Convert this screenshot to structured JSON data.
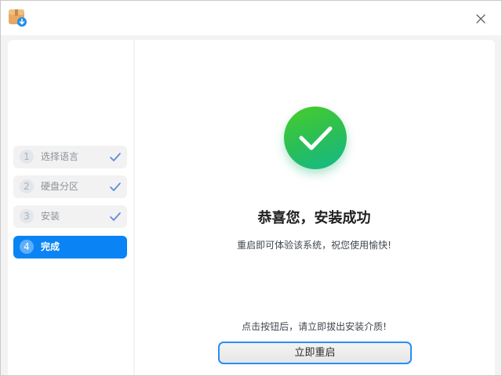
{
  "window": {
    "app_icon": "package-download-icon",
    "close_icon": "close-icon"
  },
  "sidebar": {
    "steps": [
      {
        "number": "1",
        "label": "选择语言",
        "status": "done",
        "icon": "check-icon"
      },
      {
        "number": "2",
        "label": "硬盘分区",
        "status": "done",
        "icon": "check-icon"
      },
      {
        "number": "3",
        "label": "安装",
        "status": "done",
        "icon": "check-icon"
      },
      {
        "number": "4",
        "label": "完成",
        "status": "active"
      }
    ]
  },
  "main": {
    "success_icon": "success-check-icon",
    "headline": "恭喜您，安装成功",
    "subtext": "重启即可体验该系统，祝您使用愉快!",
    "hint": "点击按钮后，请立即拔出安装介质!",
    "reboot_button_label": "立即重启"
  },
  "colors": {
    "accent": "#0a84f5",
    "success_start": "#49cd2b",
    "success_end": "#14b98a",
    "check": "#5b8bd8"
  }
}
